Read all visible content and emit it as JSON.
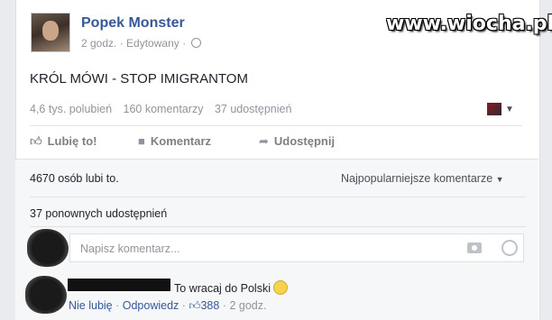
{
  "post": {
    "author": "Popek Monster",
    "time": "2 godz.",
    "edited": "Edytowany",
    "text": "KRÓL MÓWI - STOP IMIGRANTOM",
    "stats": {
      "likes": "4,6 tys. polubień",
      "comments": "160 komentarzy",
      "shares": "37 udostępnień"
    }
  },
  "watermark": "www.wiocha.pl",
  "actions": {
    "like": "Lubię to!",
    "comment": "Komentarz",
    "share": "Udostępnij"
  },
  "comments_section": {
    "likes_line": "4670 osób lubi to.",
    "sort_label": "Najpopularniejsze komentarze",
    "reshares": "37 ponownych udostępnień",
    "input_placeholder": "Napisz komentarz..."
  },
  "comment": {
    "text": "To wracaj do Polski",
    "unlike": "Nie lubię",
    "reply": "Odpowiedz",
    "like_count": "388",
    "time": "2 godz."
  }
}
